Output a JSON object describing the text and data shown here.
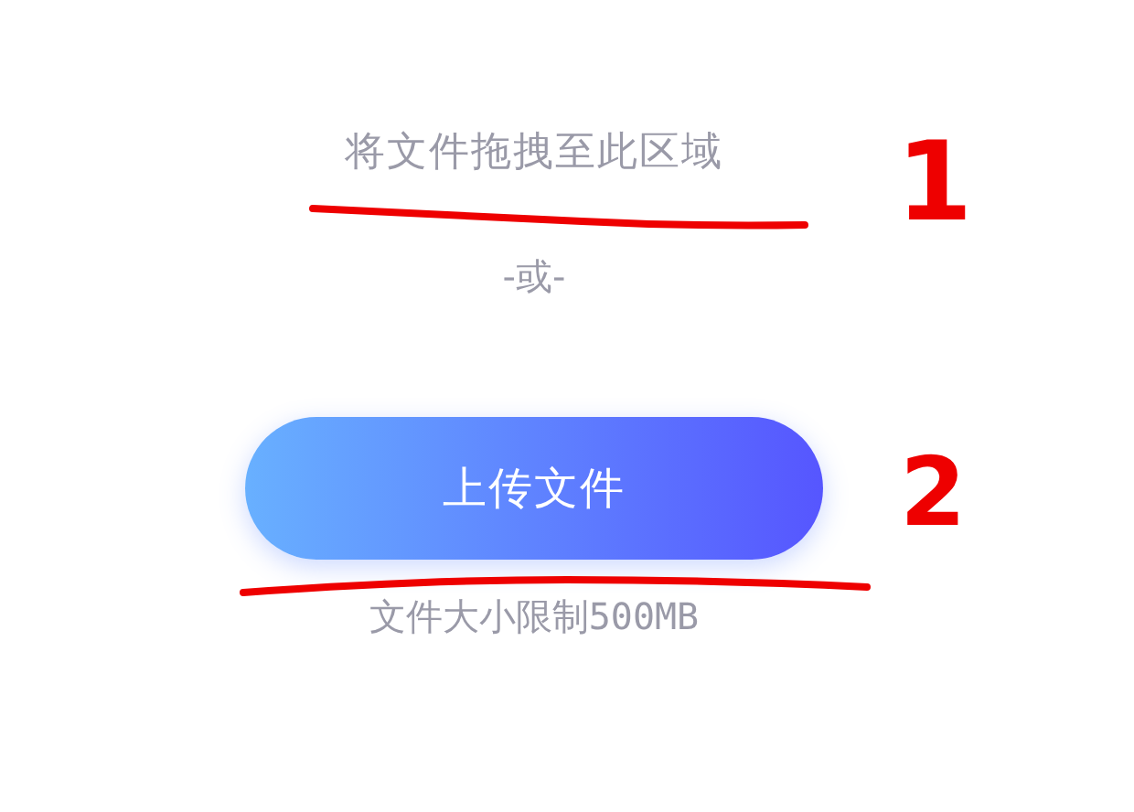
{
  "drop_zone": {
    "hint": "将文件拖拽至此区域",
    "separator": "-或-",
    "upload_button": "上传文件",
    "size_limit": "文件大小限制500MB"
  },
  "annotations": [
    {
      "number": "1"
    },
    {
      "number": "2"
    }
  ]
}
